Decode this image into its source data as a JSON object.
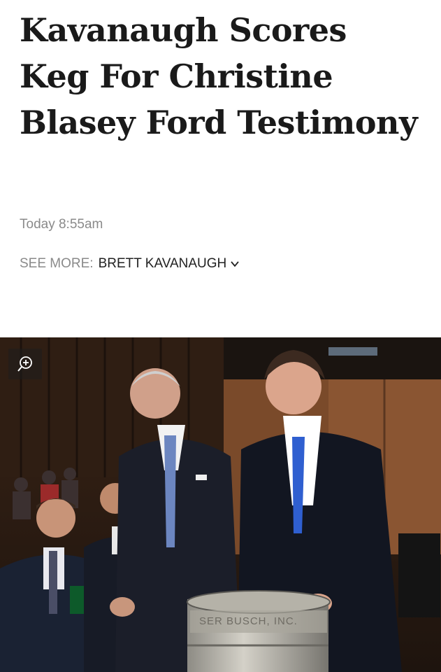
{
  "article": {
    "headline": "Kavanaugh Scores Keg For Christine Blasey Ford Testimony",
    "timestamp": "Today 8:55am",
    "see_more_label": "SEE MORE:",
    "see_more_topic": "BRETT KAVANAUGH"
  },
  "photo": {
    "keg_text": "SER BUSCH, INC."
  },
  "icons": {
    "zoom": "zoom-in-icon",
    "chevron": "chevron-down-icon"
  }
}
